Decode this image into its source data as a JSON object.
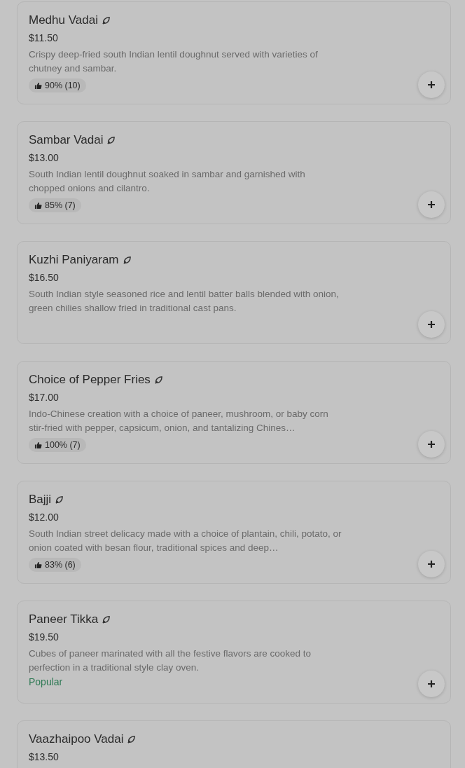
{
  "items": [
    {
      "name": "Medhu Vadai",
      "vegetarian": true,
      "price": "$11.50",
      "description": "Crispy deep-fried south Indian lentil doughnut served with varieties of chutney and sambar.",
      "badge": {
        "kind": "rating",
        "text": "90% (10)"
      }
    },
    {
      "name": "Sambar Vadai",
      "vegetarian": true,
      "price": "$13.00",
      "description": "South Indian lentil doughnut soaked in sambar and garnished with chopped onions and cilantro.",
      "badge": {
        "kind": "rating",
        "text": "85% (7)"
      }
    },
    {
      "name": "Kuzhi Paniyaram",
      "vegetarian": true,
      "price": "$16.50",
      "description": "South Indian style seasoned rice and lentil batter balls blended with onion, green chilies shallow fried in traditional cast pans."
    },
    {
      "name": "Choice of Pepper Fries",
      "vegetarian": true,
      "price": "$17.00",
      "description": "Indo-Chinese creation with a choice of paneer, mushroom, or baby corn stir-fried with pepper, capsicum, onion, and tantalizing Chines…",
      "badge": {
        "kind": "rating",
        "text": "100% (7)"
      }
    },
    {
      "name": "Bajji",
      "vegetarian": true,
      "price": "$12.00",
      "description": "South Indian street delicacy made with a choice of plantain, chili, potato, or onion coated with besan flour, traditional spices and deep…",
      "badge": {
        "kind": "rating",
        "text": "83% (6)"
      }
    },
    {
      "name": "Paneer Tikka",
      "vegetarian": true,
      "price": "$19.50",
      "description": "Cubes of paneer marinated with all the festive flavors are cooked to perfection in a traditional style clay oven.",
      "badge": {
        "kind": "popular",
        "text": "Popular"
      }
    },
    {
      "name": "Vaazhaipoo Vadai",
      "vegetarian": true,
      "price": "$13.50"
    }
  ]
}
